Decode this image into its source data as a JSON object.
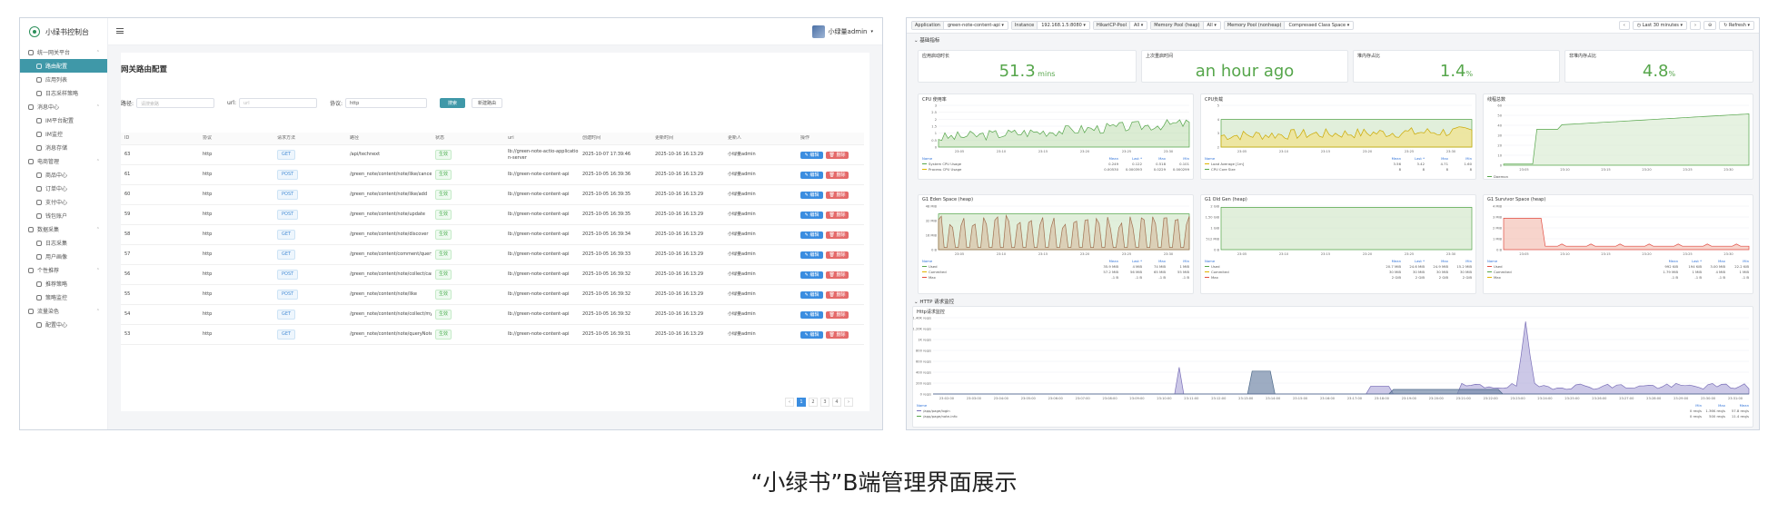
{
  "admin": {
    "brand": "小绿书控制台",
    "menu": [
      {
        "type": "grp",
        "label": "统一网关平台"
      },
      {
        "type": "item",
        "label": "路由配置",
        "active": true
      },
      {
        "type": "item",
        "label": "应用列表"
      },
      {
        "type": "item",
        "label": "日志采样策略"
      },
      {
        "type": "grp",
        "label": "消息中心"
      },
      {
        "type": "item",
        "label": "IM平台配置"
      },
      {
        "type": "item",
        "label": "IM监控"
      },
      {
        "type": "item",
        "label": "消息存储"
      },
      {
        "type": "grp",
        "label": "电商管理"
      },
      {
        "type": "item",
        "label": "商品中心"
      },
      {
        "type": "item",
        "label": "订单中心"
      },
      {
        "type": "item",
        "label": "支付中心"
      },
      {
        "type": "item",
        "label": "钱包账户"
      },
      {
        "type": "grp",
        "label": "数据采集"
      },
      {
        "type": "item",
        "label": "日志采集"
      },
      {
        "type": "item",
        "label": "用户画像"
      },
      {
        "type": "grp",
        "label": "个性推荐"
      },
      {
        "type": "item",
        "label": "推荐策略"
      },
      {
        "type": "item",
        "label": "策略监控"
      },
      {
        "type": "grp",
        "label": "流量染色"
      },
      {
        "type": "item",
        "label": "配置中心"
      }
    ],
    "user": "小绿量admin",
    "page_title": "网关路由配置",
    "filters": {
      "path_label": "路径:",
      "path_placeholder": "请搜索路",
      "url_label": "url:",
      "url_placeholder": "url",
      "proto_label": "协议:",
      "proto_value": "http",
      "search": "搜索",
      "add": "新建路由"
    },
    "columns": [
      "ID",
      "协议",
      "请求方法",
      "路径",
      "状态",
      "uri",
      "创建时间",
      "更新时间",
      "更新人",
      "操作"
    ],
    "rows": [
      [
        "63",
        "http",
        "GET",
        "/api/technext",
        "生效",
        "lb://green-note-actio-applicatio n-server",
        "2025-10-07 17:39:46",
        "2025-10-16 16:13:29",
        "小绿量admin"
      ],
      [
        "61",
        "http",
        "POST",
        "/green_note/content/note/like/cancel",
        "生效",
        "lb://green-note-content-api",
        "2025-10-05 16:39:36",
        "2025-10-16 16:13:29",
        "小绿量admin"
      ],
      [
        "60",
        "http",
        "POST",
        "/green_note/content/note/like/add",
        "生效",
        "lb://green-note-content-api",
        "2025-10-05 16:39:35",
        "2025-10-16 16:13:29",
        "小绿量admin"
      ],
      [
        "59",
        "http",
        "POST",
        "/green_note/content/note/update",
        "生效",
        "lb://green-note-content-api",
        "2025-10-05 16:39:35",
        "2025-10-16 16:13:29",
        "小绿量admin"
      ],
      [
        "58",
        "http",
        "GET",
        "/green_note/content/note/discover",
        "生效",
        "lb://green-note-content-api",
        "2025-10-05 16:39:34",
        "2025-10-16 16:13:29",
        "小绿量admin"
      ],
      [
        "57",
        "http",
        "GET",
        "/green_note/content/comment/queryReplaceInPage",
        "生效",
        "lb://green-note-content-api",
        "2025-10-05 16:39:33",
        "2025-10-16 16:13:29",
        "小绿量admin"
      ],
      [
        "56",
        "http",
        "POST",
        "/green_note/content/note/collect/cancel",
        "生效",
        "lb://green-note-content-api",
        "2025-10-05 16:39:32",
        "2025-10-16 16:13:29",
        "小绿量admin"
      ],
      [
        "55",
        "http",
        "POST",
        "/green_note/content/note/like",
        "生效",
        "lb://green-note-content-api",
        "2025-10-05 16:39:32",
        "2025-10-16 16:13:29",
        "小绿量admin"
      ],
      [
        "54",
        "http",
        "GET",
        "/green_note/content/note/collect/myCollectRecord",
        "生效",
        "lb://green-note-content-api",
        "2025-10-05 16:39:32",
        "2025-10-16 16:13:29",
        "小绿量admin"
      ],
      [
        "53",
        "http",
        "GET",
        "/green_note/content/note/queryNoteByUserId",
        "生效",
        "lb://green-note-content-api",
        "2025-10-05 16:39:31",
        "2025-10-16 16:13:29",
        "小绿量admin"
      ]
    ],
    "actions": {
      "edit": "编辑",
      "delete": "删除"
    },
    "pages": [
      "‹",
      "1",
      "2",
      "3",
      "4",
      "›"
    ]
  },
  "grafana": {
    "vars": [
      {
        "k": "Application",
        "v": "green-note-content-api"
      },
      {
        "k": "Instance",
        "v": "192.168.1.5:8080"
      },
      {
        "k": "HikariCP-Pool",
        "v": "All"
      },
      {
        "k": "Memory Pool (heap)",
        "v": "All"
      },
      {
        "k": "Memory Pool (nonheap)",
        "v": "Compressed Class Space"
      }
    ],
    "time_range": "Last 30 minutes",
    "refresh": "Refresh",
    "row_basic": "基础指标",
    "row_http": "HTTP 请求监控",
    "stats": [
      {
        "title": "应用启动时长",
        "value": "51.3",
        "unit": " mins",
        "color": "#56a64b"
      },
      {
        "title": "上次重启时间",
        "value": "an hour ago",
        "unit": "",
        "color": "#56a64b"
      },
      {
        "title": "堆内存占比",
        "value": "1.4",
        "unit": "%",
        "color": "#56a64b"
      },
      {
        "title": "非堆内存占比",
        "value": "4.8",
        "unit": "%",
        "color": "#56a64b"
      }
    ],
    "panels": {
      "cpu": {
        "title": "CPU 使用率",
        "legend": [
          [
            "System CPU Usage",
            "0.249",
            "0.122",
            "0.518",
            "0.101"
          ],
          [
            "Process CPU Usage",
            "0.00530",
            "0.000393",
            "0.0229",
            "0.000299"
          ]
        ],
        "cols": [
          "Name",
          "Mean",
          "Last *",
          "Max",
          "Min"
        ]
      },
      "load": {
        "title": "CPU负载",
        "legend": [
          [
            "Load Average [1m]",
            "3.56",
            "3.42",
            "4.71",
            "1.60"
          ],
          [
            "CPU Core Size",
            "8",
            "8",
            "8",
            "8"
          ]
        ],
        "cols": [
          "Name",
          "Mean",
          "Last *",
          "Max",
          "Min"
        ]
      },
      "threads": {
        "title": "线程总数",
        "legend": [
          [
            "Daemon",
            "",
            "",
            "",
            ""
          ]
        ]
      },
      "eden": {
        "title": "G1 Eden Space (heap)",
        "legend": [
          [
            "Used",
            "35.9 MiB",
            "4 MiB",
            "74 MiB",
            "1 MiB"
          ],
          [
            "Commited",
            "57.2 MiB",
            "56 MiB",
            "65 MiB",
            "55 MiB"
          ],
          [
            "Max",
            "-1 B",
            "-1 B",
            "-1 B",
            "-1 B"
          ]
        ],
        "cols": [
          "Name",
          "Mean",
          "Last *",
          "Max",
          "Min"
        ]
      },
      "old": {
        "title": "G1 Old Gen (heap)",
        "legend": [
          [
            "Used",
            "20.7 MiB",
            "24.6 MiB",
            "24.9 MiB",
            "15.2 MiB"
          ],
          [
            "Commited",
            "30 MiB",
            "30 MiB",
            "30 MiB",
            "30 MiB"
          ],
          [
            "Max",
            "2 GiB",
            "2 GiB",
            "2 GiB",
            "2 GiB"
          ]
        ],
        "cols": [
          "Name",
          "Mean",
          "Last *",
          "Max",
          "Min"
        ]
      },
      "surv": {
        "title": "G1 Survivor Space (heap)",
        "legend": [
          [
            "Used",
            "992 KiB",
            "194 KiB",
            "3.00 MiB",
            "22.2 KiB"
          ],
          [
            "Commited",
            "1.79 MiB",
            "1 MiB",
            "4 MiB",
            "1 MiB"
          ],
          [
            "Max",
            "-1 B",
            "-1 B",
            "-1 B",
            "-1 B"
          ]
        ],
        "cols": [
          "Name",
          "Mean",
          "Last *",
          "Max",
          "Min"
        ]
      },
      "http": {
        "title": "Http请求监控",
        "legend": [
          [
            "/app/page/login",
            "0 req/s",
            "1.36K req/s",
            "57.8 req/s"
          ],
          [
            "/app/page/note-info",
            "0 req/s",
            "500 req/s",
            "11.4 req/s"
          ]
        ],
        "cols": [
          "Name",
          "Min",
          "Max",
          "Mean"
        ]
      }
    },
    "axes": {
      "cpu_y": [
        "0",
        "0.5",
        "1",
        "1.5",
        "2",
        "2.5",
        "3"
      ],
      "cpu_x": [
        "23:05",
        "23:10",
        "23:15",
        "23:20",
        "23:25",
        "23:30"
      ],
      "load_y": [
        "2",
        "3",
        "4",
        "5"
      ],
      "thr_y": [
        "0",
        "10",
        "20",
        "30",
        "40",
        "50",
        "60"
      ],
      "eden_y": [
        "0 B",
        "16 MiB",
        "32 MiB",
        "48 MiB"
      ],
      "old_y": [
        "0 B",
        "512 MiB",
        "1 GiB",
        "1.50 GiB",
        "2 GiB"
      ],
      "surv_y": [
        "0 B",
        "1 MiB",
        "2 MiB",
        "3 MiB",
        "4 MiB"
      ],
      "http_y": [
        "0 req/s",
        "200 req/s",
        "400 req/s",
        "600 req/s",
        "800 req/s",
        "1K req/s",
        "1.20K req/s",
        "1.40K req/s"
      ],
      "http_x": [
        "23:02:00",
        "23:03:00",
        "23:04:00",
        "23:05:00",
        "23:06:00",
        "23:07:00",
        "23:08:00",
        "23:09:00",
        "23:10:00",
        "23:11:00",
        "23:12:00",
        "23:13:00",
        "23:14:00",
        "23:15:00",
        "23:16:00",
        "23:17:00",
        "23:18:00",
        "23:19:00",
        "23:20:00",
        "23:21:00",
        "23:22:00",
        "23:23:00",
        "23:24:00",
        "23:25:00",
        "23:26:00",
        "23:27:00",
        "23:28:00",
        "23:29:00",
        "23:30:00",
        "23:31:00"
      ]
    }
  },
  "caption": "“小绿书”B端管理界面展示"
}
